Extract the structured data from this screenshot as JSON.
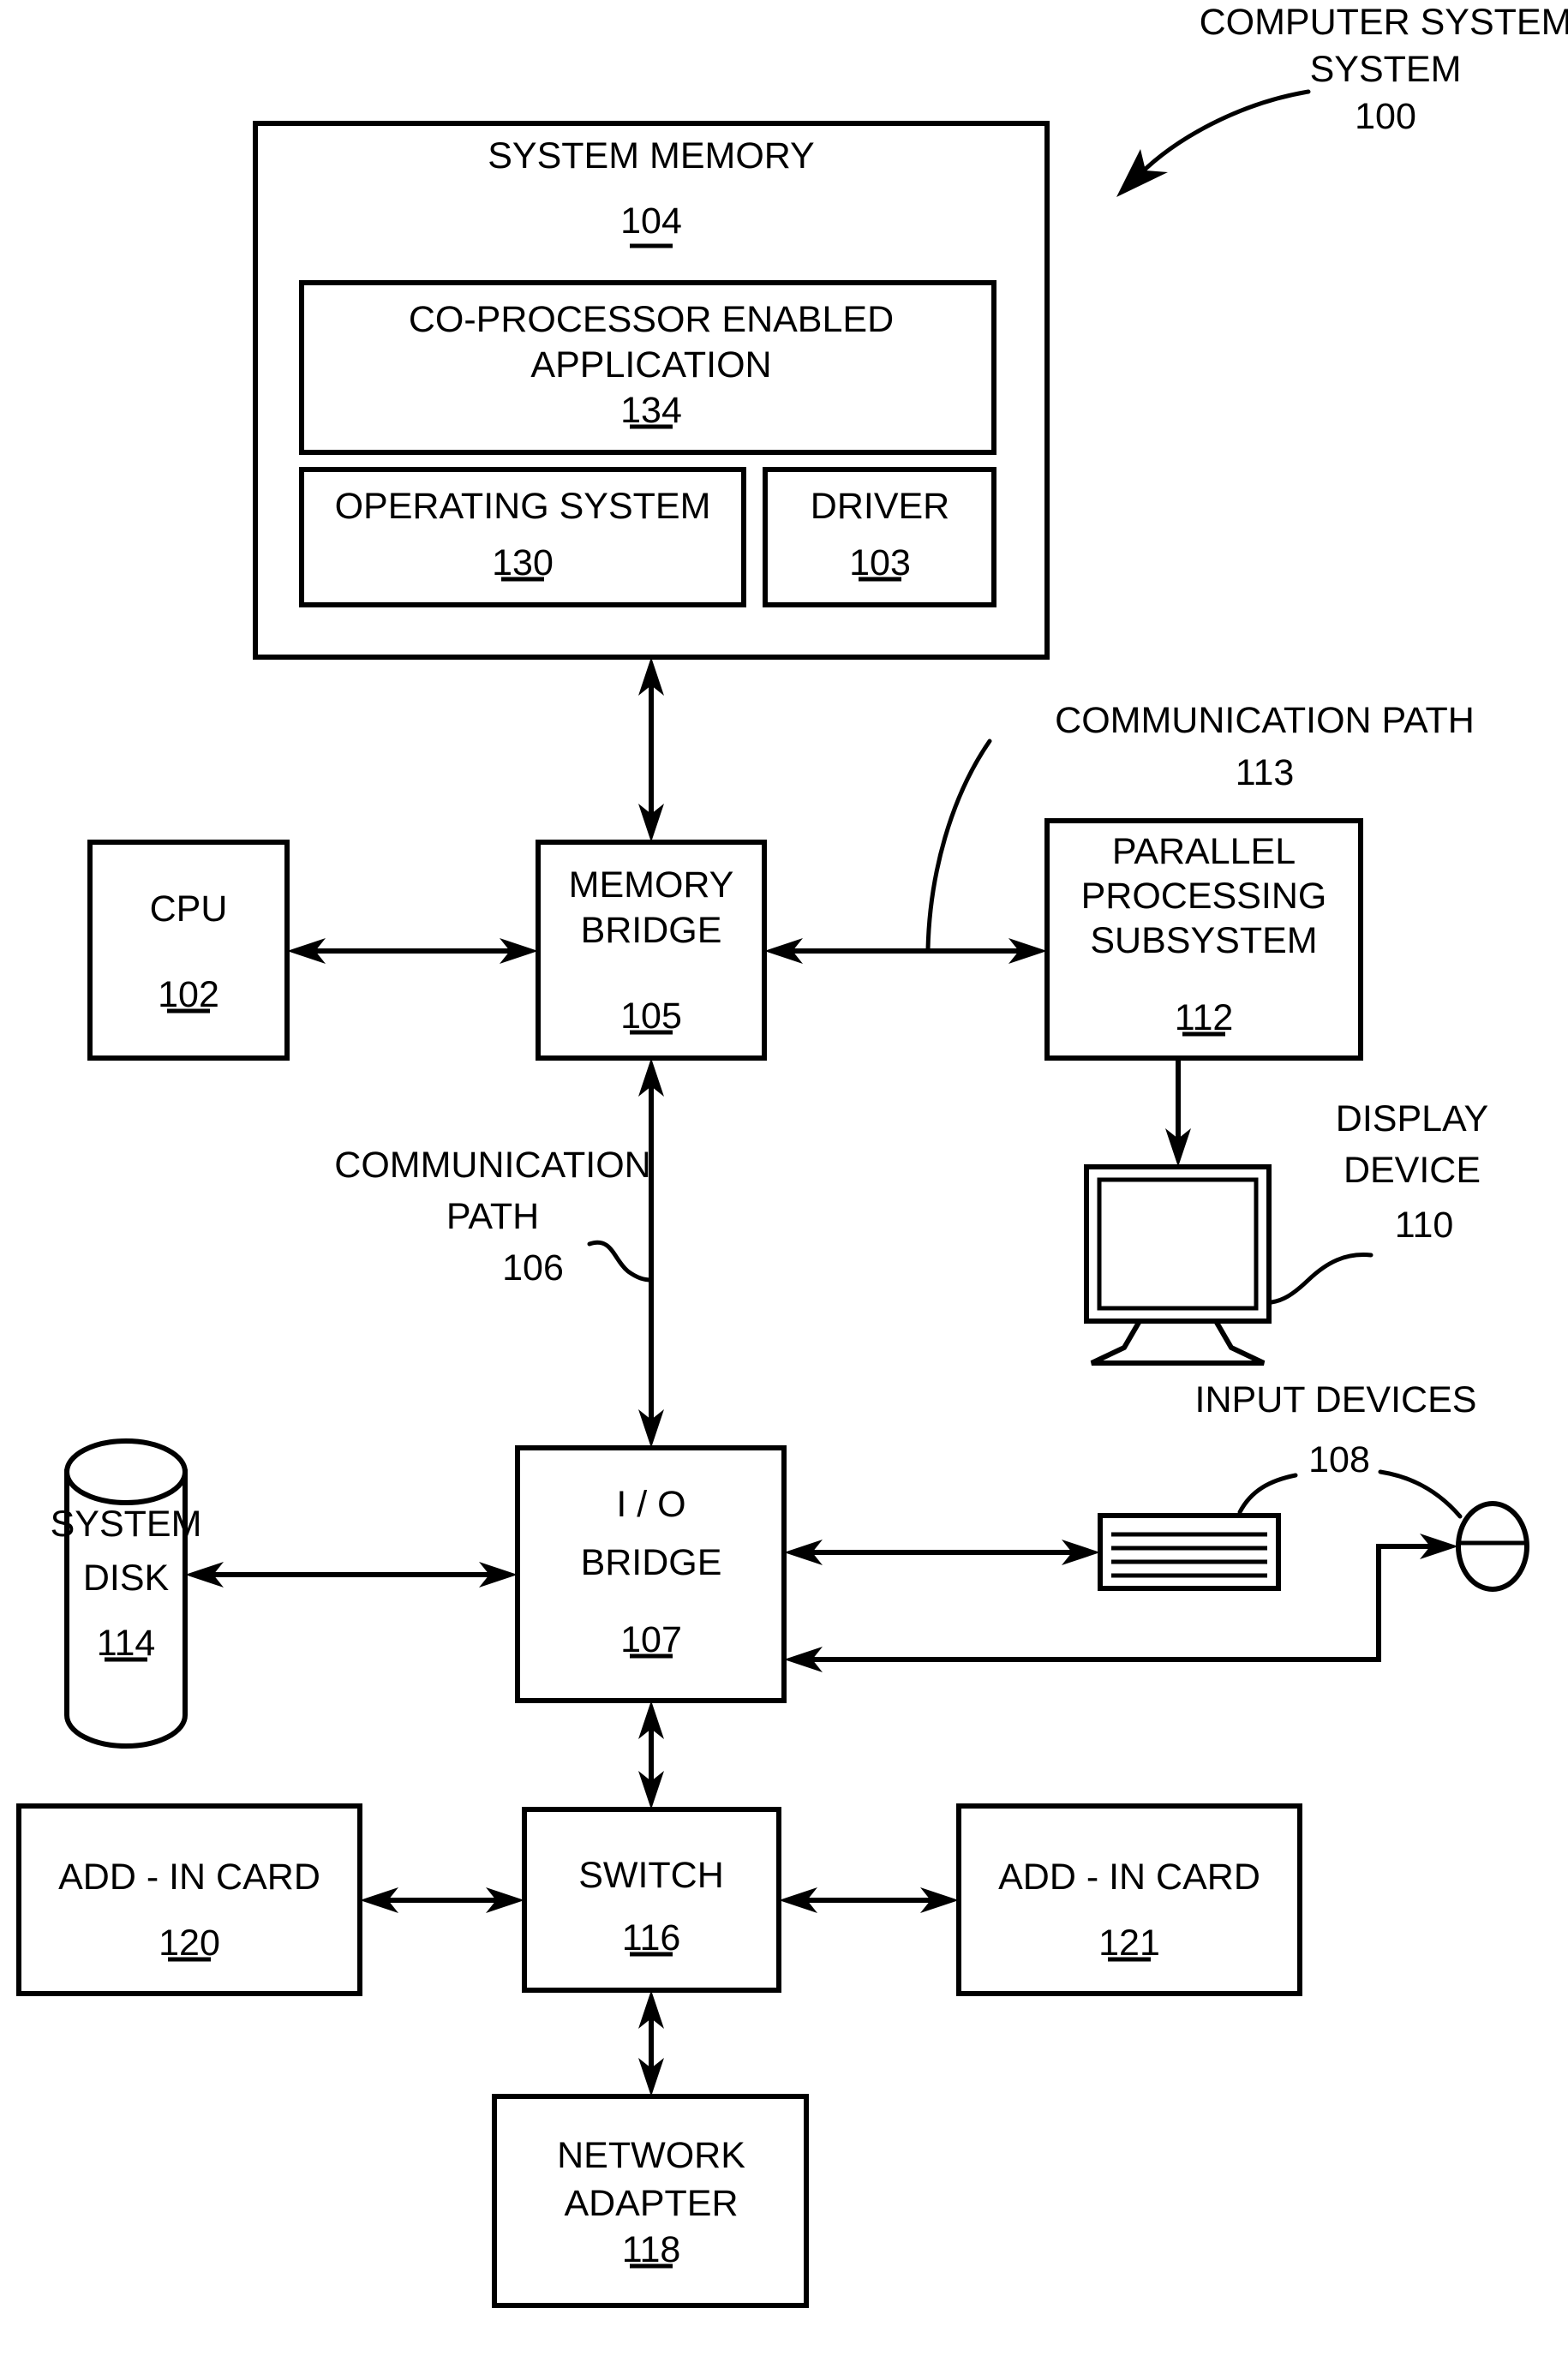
{
  "figure": {
    "title_label": "COMPUTER SYSTEM",
    "title_number": "100",
    "background_color": "#ffffff",
    "line_color": "#000000"
  },
  "blocks": {
    "system_memory": {
      "label": "SYSTEM MEMORY",
      "number": "104"
    },
    "coprocessor_app": {
      "label_line1": "CO-PROCESSOR ENABLED",
      "label_line2": "APPLICATION",
      "number": "134"
    },
    "operating_system": {
      "label": "OPERATING SYSTEM",
      "number": "130"
    },
    "driver": {
      "label": "DRIVER",
      "number": "103"
    },
    "cpu": {
      "label": "CPU",
      "number": "102"
    },
    "memory_bridge": {
      "label_line1": "MEMORY",
      "label_line2": "BRIDGE",
      "number": "105"
    },
    "parallel_processing_subsystem": {
      "label_line1": "PARALLEL",
      "label_line2": "PROCESSING",
      "label_line3": "SUBSYSTEM",
      "number": "112"
    },
    "display_device": {
      "label_line1": "DISPLAY",
      "label_line2": "DEVICE",
      "number": "110"
    },
    "input_devices": {
      "label": "INPUT  DEVICES",
      "number": "108"
    },
    "system_disk": {
      "label_line1": "SYSTEM",
      "label_line2": "DISK",
      "number": "114"
    },
    "io_bridge": {
      "label_line1": "I / O",
      "label_line2": "BRIDGE",
      "number": "107"
    },
    "add_in_card_left": {
      "label": "ADD - IN CARD",
      "number": "120"
    },
    "add_in_card_right": {
      "label": "ADD - IN CARD",
      "number": "121"
    },
    "switch": {
      "label": "SWITCH",
      "number": "116"
    },
    "network_adapter": {
      "label_line1": "NETWORK",
      "label_line2": "ADAPTER",
      "number": "118"
    }
  },
  "annotations": {
    "communication_path_113": {
      "label": "COMMUNICATION PATH",
      "number": "113"
    },
    "communication_path_106": {
      "label_line1": "COMMUNICATION",
      "label_line2": "PATH",
      "number": "106"
    }
  }
}
